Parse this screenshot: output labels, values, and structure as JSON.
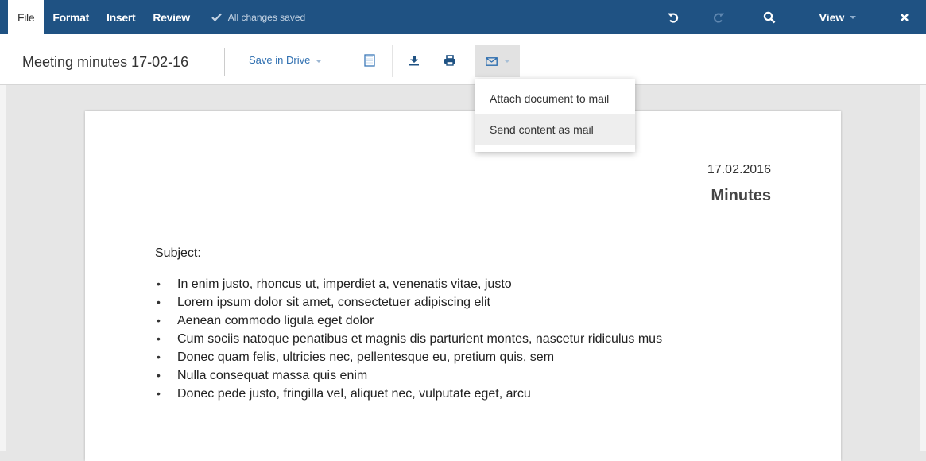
{
  "menubar": {
    "tabs": [
      {
        "label": "File"
      },
      {
        "label": "Format"
      },
      {
        "label": "Insert"
      },
      {
        "label": "Review"
      }
    ],
    "save_status": "All changes saved",
    "view_label": "View",
    "colors": {
      "bar": "#1f5283",
      "active_tab": "#ffffff"
    }
  },
  "toolbar": {
    "document_name": "Meeting minutes 17-02-16",
    "save_in_drive_label": "Save in Drive",
    "icons": [
      "document-icon",
      "download-icon",
      "print-icon",
      "mail-icon"
    ]
  },
  "mail_menu": {
    "items": [
      {
        "label": "Attach document to mail"
      },
      {
        "label": "Send content as mail"
      }
    ]
  },
  "document": {
    "date": "17.02.2016",
    "heading": "Minutes",
    "subject_label": "Subject:",
    "bullets": [
      "In enim justo, rhoncus ut, imperdiet a, venenatis vitae, justo",
      "Lorem ipsum dolor sit amet, consectetuer adipiscing elit",
      "Aenean commodo ligula eget dolor",
      "Cum sociis natoque penatibus et magnis dis parturient montes, nascetur ridiculus mus",
      "Donec quam felis, ultricies nec, pellentesque eu, pretium quis, sem",
      "Nulla consequat massa quis enim",
      "Donec pede justo, fringilla vel, aliquet nec, vulputate eget, arcu"
    ]
  }
}
